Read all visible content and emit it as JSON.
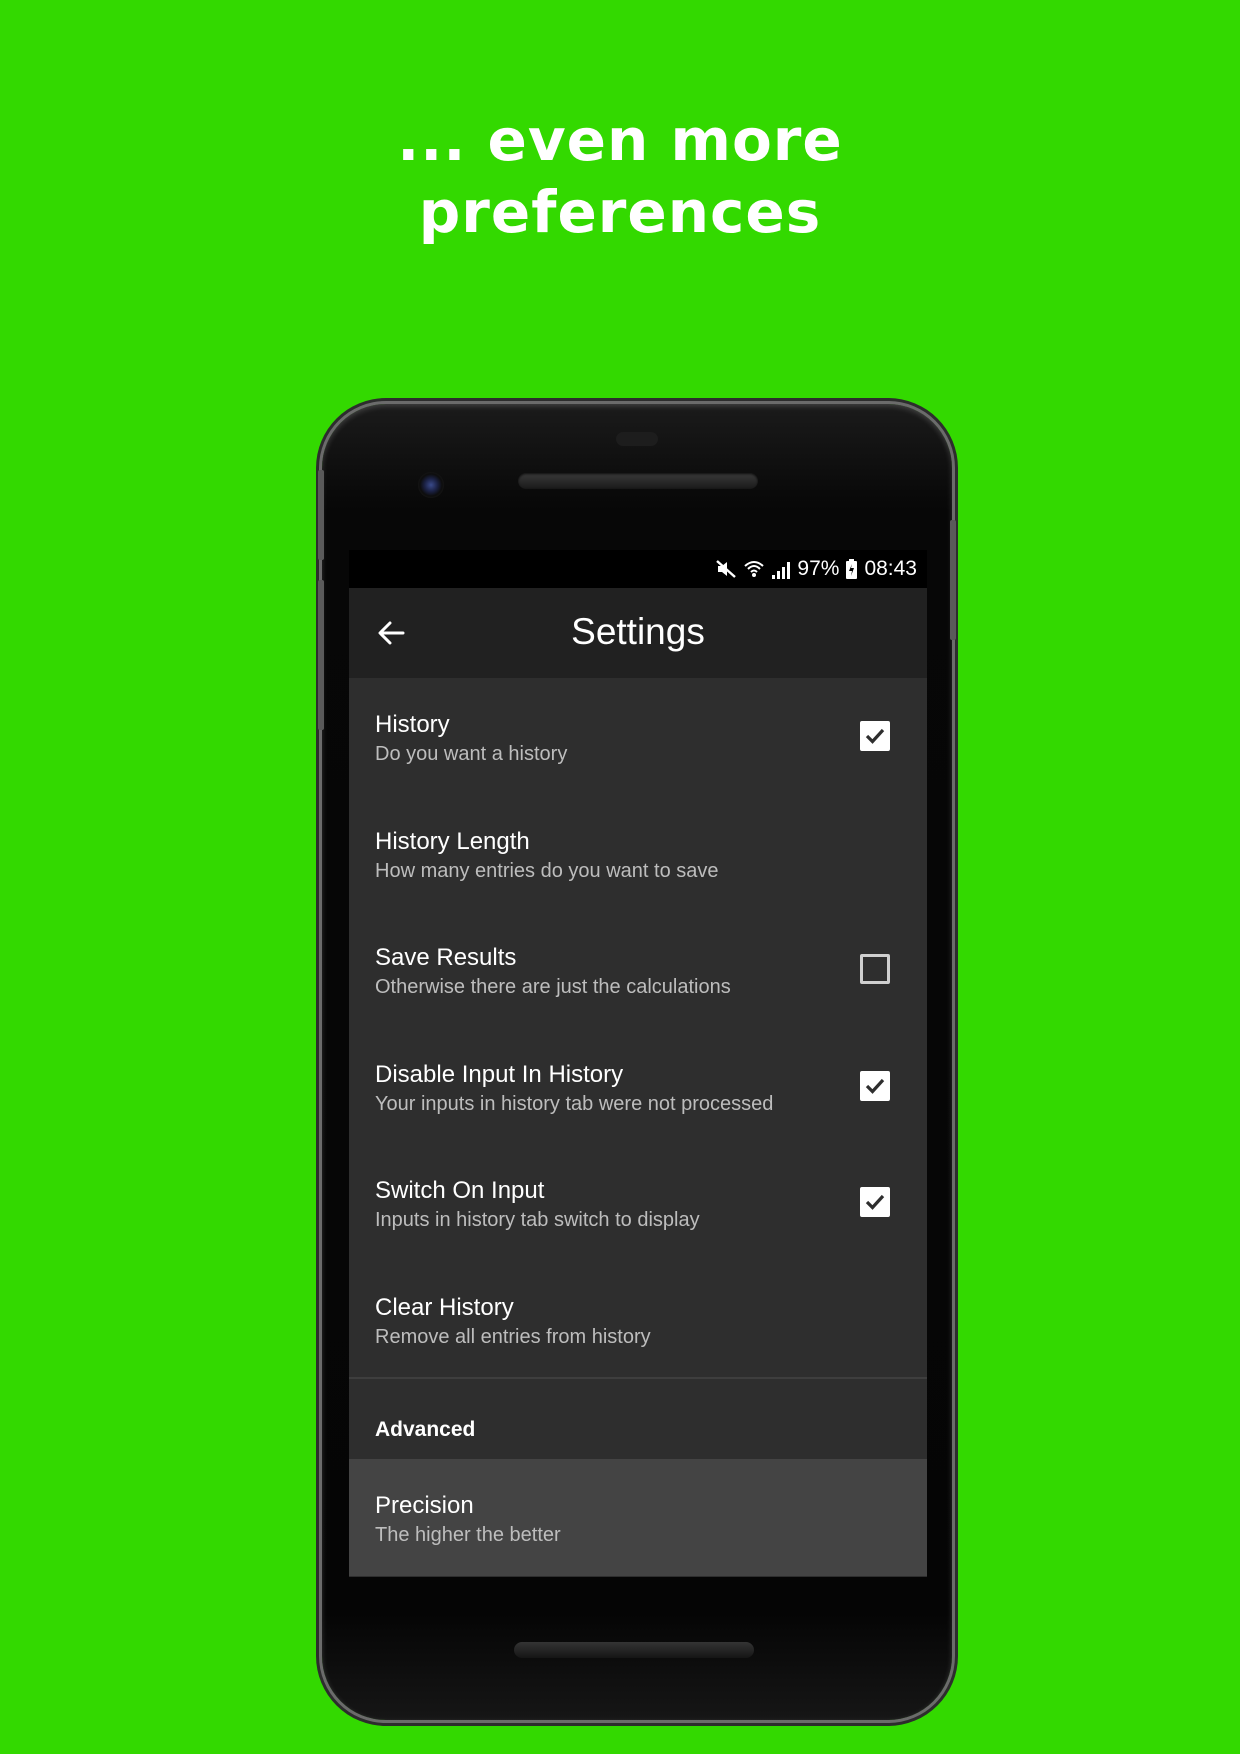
{
  "headline": {
    "line1": "... even more",
    "line2": "preferences"
  },
  "status_bar": {
    "battery": "97%",
    "time": "08:43",
    "icons": [
      "mute-icon",
      "wifi-icon",
      "signal-icon",
      "battery-icon"
    ]
  },
  "app_bar": {
    "title": "Settings",
    "back_icon": "arrow-left-icon"
  },
  "preferences": [
    {
      "title": "History",
      "summary": "Do you want a history",
      "checkbox": true,
      "checked": true
    },
    {
      "title": "History Length",
      "summary": "How many entries do you want to save",
      "checkbox": false
    },
    {
      "title": "Save Results",
      "summary": "Otherwise there are just the calculations",
      "checkbox": true,
      "checked": false
    },
    {
      "title": "Disable Input In History",
      "summary": "Your inputs in history tab were not processed",
      "checkbox": true,
      "checked": true
    },
    {
      "title": "Switch On Input",
      "summary": "Inputs in history tab switch to display",
      "checkbox": true,
      "checked": true
    },
    {
      "title": "Clear History",
      "summary": "Remove all entries from history",
      "checkbox": false
    }
  ],
  "advanced": {
    "category": "Advanced",
    "items": [
      {
        "title": "Precision",
        "summary": "The higher the better"
      }
    ]
  },
  "colors": {
    "background": "#33d900",
    "screen": "#2e2e2e",
    "app_bar": "#212121",
    "highlight": "#444444"
  }
}
